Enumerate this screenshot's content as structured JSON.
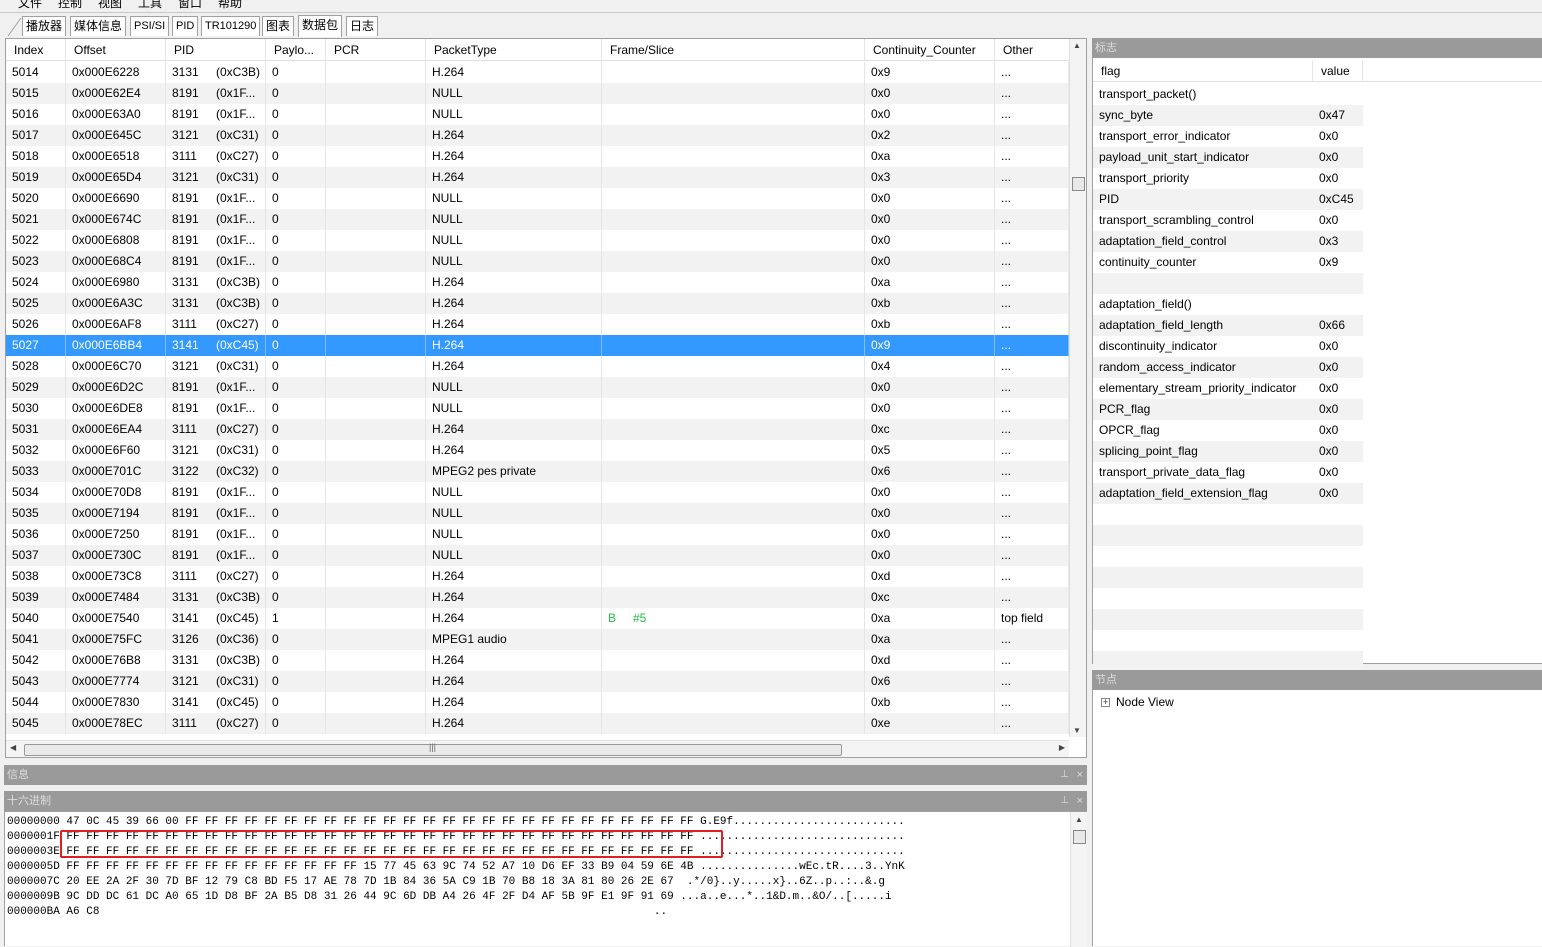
{
  "menu": {
    "items": [
      "文件",
      "控制",
      "视图",
      "工具",
      "窗口",
      "帮助"
    ]
  },
  "tabs": [
    {
      "label": "播放器",
      "selected": false
    },
    {
      "label": "媒体信息",
      "selected": false
    },
    {
      "label": "PSI/SI",
      "selected": false
    },
    {
      "label": "PID",
      "selected": false
    },
    {
      "label": "TR101290",
      "selected": false
    },
    {
      "label": "图表",
      "selected": false
    },
    {
      "label": "数据包",
      "selected": true
    },
    {
      "label": "日志",
      "selected": false
    }
  ],
  "grid": {
    "columns": [
      "Index",
      "Offset",
      "PID",
      "Paylo...",
      "PCR",
      "PacketType",
      "Frame/Slice",
      "Continuity_Counter",
      "Other"
    ],
    "selected_index": "5027",
    "rows": [
      {
        "index": "5014",
        "offset": "0x000E6228",
        "pid": "3131",
        "pid_hex": "(0xC3B)",
        "payload": "0",
        "pcr": "",
        "type": "H.264",
        "frame": "",
        "frame_num": "",
        "cc": "0x9",
        "other": "..."
      },
      {
        "index": "5015",
        "offset": "0x000E62E4",
        "pid": "8191",
        "pid_hex": "(0x1F...",
        "payload": "0",
        "pcr": "",
        "type": "NULL",
        "frame": "",
        "frame_num": "",
        "cc": "0x0",
        "other": "..."
      },
      {
        "index": "5016",
        "offset": "0x000E63A0",
        "pid": "8191",
        "pid_hex": "(0x1F...",
        "payload": "0",
        "pcr": "",
        "type": "NULL",
        "frame": "",
        "frame_num": "",
        "cc": "0x0",
        "other": "..."
      },
      {
        "index": "5017",
        "offset": "0x000E645C",
        "pid": "3121",
        "pid_hex": "(0xC31)",
        "payload": "0",
        "pcr": "",
        "type": "H.264",
        "frame": "",
        "frame_num": "",
        "cc": "0x2",
        "other": "..."
      },
      {
        "index": "5018",
        "offset": "0x000E6518",
        "pid": "3111",
        "pid_hex": "(0xC27)",
        "payload": "0",
        "pcr": "",
        "type": "H.264",
        "frame": "",
        "frame_num": "",
        "cc": "0xa",
        "other": "..."
      },
      {
        "index": "5019",
        "offset": "0x000E65D4",
        "pid": "3121",
        "pid_hex": "(0xC31)",
        "payload": "0",
        "pcr": "",
        "type": "H.264",
        "frame": "",
        "frame_num": "",
        "cc": "0x3",
        "other": "..."
      },
      {
        "index": "5020",
        "offset": "0x000E6690",
        "pid": "8191",
        "pid_hex": "(0x1F...",
        "payload": "0",
        "pcr": "",
        "type": "NULL",
        "frame": "",
        "frame_num": "",
        "cc": "0x0",
        "other": "..."
      },
      {
        "index": "5021",
        "offset": "0x000E674C",
        "pid": "8191",
        "pid_hex": "(0x1F...",
        "payload": "0",
        "pcr": "",
        "type": "NULL",
        "frame": "",
        "frame_num": "",
        "cc": "0x0",
        "other": "..."
      },
      {
        "index": "5022",
        "offset": "0x000E6808",
        "pid": "8191",
        "pid_hex": "(0x1F...",
        "payload": "0",
        "pcr": "",
        "type": "NULL",
        "frame": "",
        "frame_num": "",
        "cc": "0x0",
        "other": "..."
      },
      {
        "index": "5023",
        "offset": "0x000E68C4",
        "pid": "8191",
        "pid_hex": "(0x1F...",
        "payload": "0",
        "pcr": "",
        "type": "NULL",
        "frame": "",
        "frame_num": "",
        "cc": "0x0",
        "other": "..."
      },
      {
        "index": "5024",
        "offset": "0x000E6980",
        "pid": "3131",
        "pid_hex": "(0xC3B)",
        "payload": "0",
        "pcr": "",
        "type": "H.264",
        "frame": "",
        "frame_num": "",
        "cc": "0xa",
        "other": "..."
      },
      {
        "index": "5025",
        "offset": "0x000E6A3C",
        "pid": "3131",
        "pid_hex": "(0xC3B)",
        "payload": "0",
        "pcr": "",
        "type": "H.264",
        "frame": "",
        "frame_num": "",
        "cc": "0xb",
        "other": "..."
      },
      {
        "index": "5026",
        "offset": "0x000E6AF8",
        "pid": "3111",
        "pid_hex": "(0xC27)",
        "payload": "0",
        "pcr": "",
        "type": "H.264",
        "frame": "",
        "frame_num": "",
        "cc": "0xb",
        "other": "..."
      },
      {
        "index": "5027",
        "offset": "0x000E6BB4",
        "pid": "3141",
        "pid_hex": "(0xC45)",
        "payload": "0",
        "pcr": "",
        "type": "H.264",
        "frame": "",
        "frame_num": "",
        "cc": "0x9",
        "other": "..."
      },
      {
        "index": "5028",
        "offset": "0x000E6C70",
        "pid": "3121",
        "pid_hex": "(0xC31)",
        "payload": "0",
        "pcr": "",
        "type": "H.264",
        "frame": "",
        "frame_num": "",
        "cc": "0x4",
        "other": "..."
      },
      {
        "index": "5029",
        "offset": "0x000E6D2C",
        "pid": "8191",
        "pid_hex": "(0x1F...",
        "payload": "0",
        "pcr": "",
        "type": "NULL",
        "frame": "",
        "frame_num": "",
        "cc": "0x0",
        "other": "..."
      },
      {
        "index": "5030",
        "offset": "0x000E6DE8",
        "pid": "8191",
        "pid_hex": "(0x1F...",
        "payload": "0",
        "pcr": "",
        "type": "NULL",
        "frame": "",
        "frame_num": "",
        "cc": "0x0",
        "other": "..."
      },
      {
        "index": "5031",
        "offset": "0x000E6EA4",
        "pid": "3111",
        "pid_hex": "(0xC27)",
        "payload": "0",
        "pcr": "",
        "type": "H.264",
        "frame": "",
        "frame_num": "",
        "cc": "0xc",
        "other": "..."
      },
      {
        "index": "5032",
        "offset": "0x000E6F60",
        "pid": "3121",
        "pid_hex": "(0xC31)",
        "payload": "0",
        "pcr": "",
        "type": "H.264",
        "frame": "",
        "frame_num": "",
        "cc": "0x5",
        "other": "..."
      },
      {
        "index": "5033",
        "offset": "0x000E701C",
        "pid": "3122",
        "pid_hex": "(0xC32)",
        "payload": "0",
        "pcr": "",
        "type": "MPEG2 pes private",
        "frame": "",
        "frame_num": "",
        "cc": "0x6",
        "other": "..."
      },
      {
        "index": "5034",
        "offset": "0x000E70D8",
        "pid": "8191",
        "pid_hex": "(0x1F...",
        "payload": "0",
        "pcr": "",
        "type": "NULL",
        "frame": "",
        "frame_num": "",
        "cc": "0x0",
        "other": "..."
      },
      {
        "index": "5035",
        "offset": "0x000E7194",
        "pid": "8191",
        "pid_hex": "(0x1F...",
        "payload": "0",
        "pcr": "",
        "type": "NULL",
        "frame": "",
        "frame_num": "",
        "cc": "0x0",
        "other": "..."
      },
      {
        "index": "5036",
        "offset": "0x000E7250",
        "pid": "8191",
        "pid_hex": "(0x1F...",
        "payload": "0",
        "pcr": "",
        "type": "NULL",
        "frame": "",
        "frame_num": "",
        "cc": "0x0",
        "other": "..."
      },
      {
        "index": "5037",
        "offset": "0x000E730C",
        "pid": "8191",
        "pid_hex": "(0x1F...",
        "payload": "0",
        "pcr": "",
        "type": "NULL",
        "frame": "",
        "frame_num": "",
        "cc": "0x0",
        "other": "..."
      },
      {
        "index": "5038",
        "offset": "0x000E73C8",
        "pid": "3111",
        "pid_hex": "(0xC27)",
        "payload": "0",
        "pcr": "",
        "type": "H.264",
        "frame": "",
        "frame_num": "",
        "cc": "0xd",
        "other": "..."
      },
      {
        "index": "5039",
        "offset": "0x000E7484",
        "pid": "3131",
        "pid_hex": "(0xC3B)",
        "payload": "0",
        "pcr": "",
        "type": "H.264",
        "frame": "",
        "frame_num": "",
        "cc": "0xc",
        "other": "..."
      },
      {
        "index": "5040",
        "offset": "0x000E7540",
        "pid": "3141",
        "pid_hex": "(0xC45)",
        "payload": "1",
        "pcr": "",
        "type": "H.264",
        "frame": "B",
        "frame_num": "#5",
        "cc": "0xa",
        "other": "top field"
      },
      {
        "index": "5041",
        "offset": "0x000E75FC",
        "pid": "3126",
        "pid_hex": "(0xC36)",
        "payload": "0",
        "pcr": "",
        "type": "MPEG1 audio",
        "frame": "",
        "frame_num": "",
        "cc": "0xa",
        "other": "..."
      },
      {
        "index": "5042",
        "offset": "0x000E76B8",
        "pid": "3131",
        "pid_hex": "(0xC3B)",
        "payload": "0",
        "pcr": "",
        "type": "H.264",
        "frame": "",
        "frame_num": "",
        "cc": "0xd",
        "other": "..."
      },
      {
        "index": "5043",
        "offset": "0x000E7774",
        "pid": "3121",
        "pid_hex": "(0xC31)",
        "payload": "0",
        "pcr": "",
        "type": "H.264",
        "frame": "",
        "frame_num": "",
        "cc": "0x6",
        "other": "..."
      },
      {
        "index": "5044",
        "offset": "0x000E7830",
        "pid": "3141",
        "pid_hex": "(0xC45)",
        "payload": "0",
        "pcr": "",
        "type": "H.264",
        "frame": "",
        "frame_num": "",
        "cc": "0xb",
        "other": "..."
      },
      {
        "index": "5045",
        "offset": "0x000E78EC",
        "pid": "3111",
        "pid_hex": "(0xC27)",
        "payload": "0",
        "pcr": "",
        "type": "H.264",
        "frame": "",
        "frame_num": "",
        "cc": "0xe",
        "other": "..."
      }
    ]
  },
  "flags_panel": {
    "title": "标志",
    "columns": [
      "flag",
      "value"
    ],
    "rows": [
      {
        "flag": "transport_packet()",
        "value": ""
      },
      {
        "flag": "sync_byte",
        "value": "0x47"
      },
      {
        "flag": "transport_error_indicator",
        "value": "0x0"
      },
      {
        "flag": "payload_unit_start_indicator",
        "value": "0x0"
      },
      {
        "flag": "transport_priority",
        "value": "0x0"
      },
      {
        "flag": "PID",
        "value": "0xC45"
      },
      {
        "flag": "transport_scrambling_control",
        "value": "0x0"
      },
      {
        "flag": "adaptation_field_control",
        "value": "0x3"
      },
      {
        "flag": "continuity_counter",
        "value": "0x9"
      },
      {
        "flag": "",
        "value": ""
      },
      {
        "flag": "adaptation_field()",
        "value": ""
      },
      {
        "flag": "adaptation_field_length",
        "value": "0x66"
      },
      {
        "flag": "discontinuity_indicator",
        "value": "0x0"
      },
      {
        "flag": "random_access_indicator",
        "value": "0x0"
      },
      {
        "flag": "elementary_stream_priority_indicator",
        "value": "0x0"
      },
      {
        "flag": "PCR_flag",
        "value": "0x0"
      },
      {
        "flag": "OPCR_flag",
        "value": "0x0"
      },
      {
        "flag": "splicing_point_flag",
        "value": "0x0"
      },
      {
        "flag": "transport_private_data_flag",
        "value": "0x0"
      },
      {
        "flag": "adaptation_field_extension_flag",
        "value": "0x0"
      },
      {
        "flag": "",
        "value": ""
      },
      {
        "flag": "",
        "value": ""
      },
      {
        "flag": "",
        "value": ""
      },
      {
        "flag": "",
        "value": ""
      },
      {
        "flag": "",
        "value": ""
      },
      {
        "flag": "",
        "value": ""
      },
      {
        "flag": "",
        "value": ""
      },
      {
        "flag": "",
        "value": ""
      },
      {
        "flag": "",
        "value": ""
      }
    ]
  },
  "node_panel": {
    "title": "节点",
    "expander": "+",
    "item": "Node View"
  },
  "info_panel": {
    "title": "信息",
    "pin": "⊥",
    "close": "×"
  },
  "hex_panel": {
    "title": "十六进制",
    "pin": "⊥",
    "close": "×",
    "lines": [
      "00000000 47 0C 45 39 66 00 FF FF FF FF FF FF FF FF FF FF FF FF FF FF FF FF FF FF FF FF FF FF FF FF FF FF G.E9f..........................",
      "0000001F FF FF FF FF FF FF FF FF FF FF FF FF FF FF FF FF FF FF FF FF FF FF FF FF FF FF FF FF FF FF FF FF ...............................",
      "0000003E FF FF FF FF FF FF FF FF FF FF FF FF FF FF FF FF FF FF FF FF FF FF FF FF FF FF FF FF FF FF FF FF ...............................",
      "0000005D FF FF FF FF FF FF FF FF FF FF FF FF FF FF FF 15 77 45 63 9C 74 52 A7 10 D6 EF 33 B9 04 59 6E 4B ...............wEc.tR....3..YnK",
      "0000007C 20 EE 2A 2F 30 7D BF 12 79 C8 BD F5 17 AE 78 7D 1B 84 36 5A C9 1B 70 B8 18 3A 81 80 26 2E 67  .*/0}..y.....x}..6Z..p..:..&.g",
      "0000009B 9C DD DC 61 DC A0 65 1D D8 BF 2A B5 D8 31 26 44 9C 6D DB A4 26 4F 2F D4 AF 5B 9F E1 9F 91 69 ...a..e...*..1&D.m..&O/..[.....i",
      "000000BA A6 C8                                                                                    .."
    ]
  },
  "colors": {
    "selection": "#3399ff",
    "frame_label": "#22c040",
    "highlight_box": "#e02020",
    "panel_title": "#9a9a9a"
  }
}
